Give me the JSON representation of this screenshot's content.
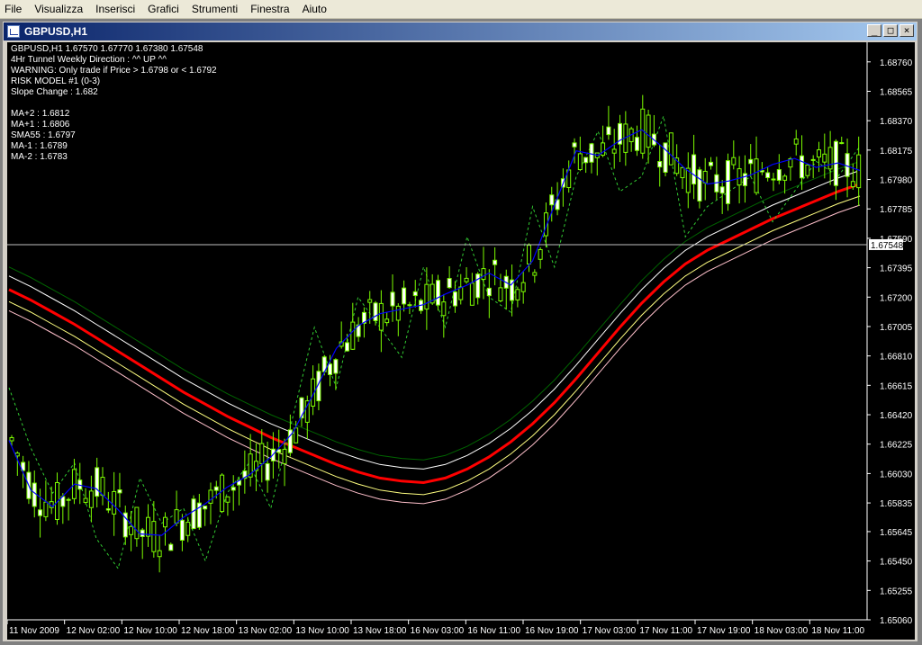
{
  "menu": [
    "File",
    "Visualizza",
    "Inserisci",
    "Grafici",
    "Strumenti",
    "Finestra",
    "Aiuto"
  ],
  "window": {
    "title": "GBPUSD,H1",
    "min": "_",
    "max": "□",
    "close": "×"
  },
  "info": [
    "GBPUSD,H1  1.67570 1.67770 1.67380 1.67548",
    "4Hr Tunnel Weekly Direction : ^^ UP ^^",
    "WARNING: Only trade if Price > 1.6798 or < 1.6792",
    "RISK MODEL #1 (0-3)",
    "Slope Change : 1.682",
    "",
    "MA+2 : 1.6812",
    "MA+1 : 1.6806",
    "SMA55 : 1.6797",
    "MA-1 : 1.6789",
    "MA-2 : 1.6783"
  ],
  "colors": {
    "candle": "#7cfc00",
    "ma_blue": "#0000ff",
    "sma55": "#ff0000",
    "ma_plus2": "#006400",
    "ma_plus1": "#ffffff",
    "ma_minus1": "#ffff80",
    "ma_minus2": "#ffc0cb",
    "dashed": "#32cd32",
    "current_price_bg": "#ffffff"
  },
  "chart_data": {
    "type": "candlestick",
    "symbol": "GBPUSD",
    "timeframe": "H1",
    "current_price": "1.67548",
    "y_ticks": [
      "1.68760",
      "1.68565",
      "1.68370",
      "1.68175",
      "1.67980",
      "1.67785",
      "1.67590",
      "1.67395",
      "1.67200",
      "1.67005",
      "1.66810",
      "1.66615",
      "1.66420",
      "1.66225",
      "1.66030",
      "1.65835",
      "1.65645",
      "1.65450",
      "1.65255",
      "1.65060"
    ],
    "ylim": [
      1.6506,
      1.6889
    ],
    "x_ticks": [
      "11 Nov 2009",
      "12 Nov 02:00",
      "12 Nov 10:00",
      "12 Nov 18:00",
      "13 Nov 02:00",
      "13 Nov 10:00",
      "13 Nov 18:00",
      "16 Nov 03:00",
      "16 Nov 11:00",
      "16 Nov 19:00",
      "17 Nov 03:00",
      "17 Nov 11:00",
      "17 Nov 19:00",
      "18 Nov 03:00",
      "18 Nov 11:00"
    ],
    "sma55": [
      1.6725,
      1.6718,
      1.671,
      1.6702,
      1.6693,
      1.6684,
      1.6675,
      1.6666,
      1.6657,
      1.6649,
      1.6641,
      1.6634,
      1.6627,
      1.6621,
      1.6615,
      1.6609,
      1.6604,
      1.66,
      1.6598,
      1.6597,
      1.66,
      1.6606,
      1.6614,
      1.6624,
      1.6636,
      1.665,
      1.6666,
      1.6683,
      1.67,
      1.6716,
      1.673,
      1.6742,
      1.6751,
      1.6758,
      1.6765,
      1.6772,
      1.6778,
      1.6784,
      1.679,
      1.6795
    ],
    "ma_blue": [
      1.6625,
      1.6592,
      1.6581,
      1.6596,
      1.6593,
      1.6579,
      1.6563,
      1.6562,
      1.6574,
      1.6583,
      1.6594,
      1.6602,
      1.6614,
      1.663,
      1.6657,
      1.6686,
      1.6701,
      1.6709,
      1.6712,
      1.6715,
      1.6722,
      1.6728,
      1.6736,
      1.6728,
      1.6744,
      1.6781,
      1.6817,
      1.6814,
      1.6824,
      1.6831,
      1.6819,
      1.6805,
      1.6795,
      1.6797,
      1.6801,
      1.6808,
      1.6812,
      1.6806,
      1.6809,
      1.6804
    ],
    "ma_dashed": [
      1.666,
      1.662,
      1.659,
      1.661,
      1.656,
      1.654,
      1.66,
      1.657,
      1.658,
      1.6545,
      1.659,
      1.661,
      1.658,
      1.664,
      1.67,
      1.666,
      1.672,
      1.67,
      1.668,
      1.674,
      1.67,
      1.676,
      1.672,
      1.671,
      1.678,
      1.674,
      1.68,
      1.683,
      1.679,
      1.68,
      1.684,
      1.676,
      1.678,
      1.679,
      1.68,
      1.677,
      1.679,
      1.681,
      1.68,
      1.682
    ]
  }
}
